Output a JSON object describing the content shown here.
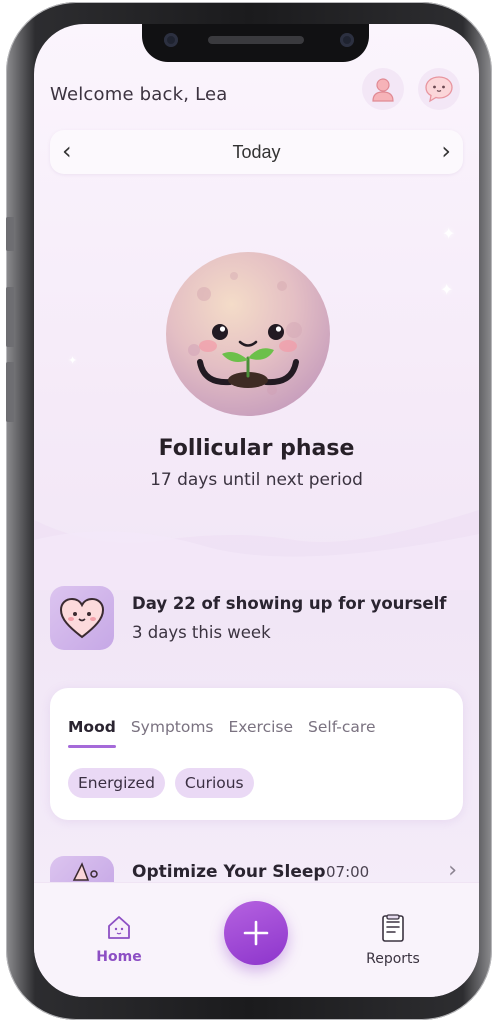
{
  "header": {
    "welcome_text": "Welcome back, Lea",
    "profile_icon": "user-icon",
    "chat_icon": "chat-bubble-icon"
  },
  "date_nav": {
    "label": "Today",
    "prev_icon": "chevron-left-icon",
    "next_icon": "chevron-right-icon"
  },
  "phase": {
    "illustration": "moon-mascot-with-sprout",
    "title": "Follicular phase",
    "subtitle": "17 days until next period"
  },
  "streak": {
    "icon": "heart-face-icon",
    "title": "Day 22 of showing up for yourself",
    "subtitle": "3 days this week"
  },
  "log_card": {
    "tabs": [
      {
        "label": "Mood",
        "active": true
      },
      {
        "label": "Symptoms",
        "active": false
      },
      {
        "label": "Exercise",
        "active": false
      },
      {
        "label": "Self-care",
        "active": false
      }
    ],
    "chips": [
      "Energized",
      "Curious"
    ]
  },
  "reminder": {
    "icon": "sleep-icon",
    "title": "Optimize Your Sleep",
    "time": "07:00"
  },
  "bottom_nav": {
    "home_label": "Home",
    "add_icon": "plus-icon",
    "reports_label": "Reports"
  },
  "colors": {
    "accent": "#9b4fd6",
    "background": "#f5eaf8",
    "chip": "#ead9f5"
  }
}
